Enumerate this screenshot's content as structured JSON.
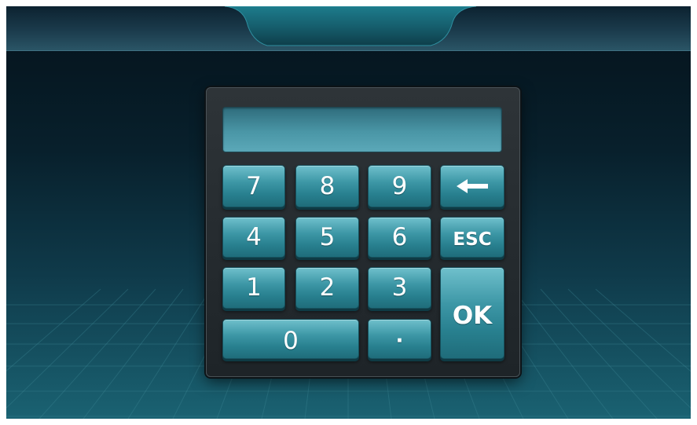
{
  "display": {
    "value": ""
  },
  "keys": {
    "k7": "7",
    "k8": "8",
    "k9": "9",
    "k4": "4",
    "k5": "5",
    "k6": "6",
    "k1": "1",
    "k2": "2",
    "k3": "3",
    "k0": "0",
    "kdot": "·",
    "esc": "ESC",
    "ok": "OK"
  },
  "icons": {
    "backspace": "left-arrow-icon"
  },
  "colors": {
    "key_top": "#6fc0cc",
    "key_bottom": "#1f6c7a",
    "panel": "#262c30",
    "display": "#4a96a6",
    "background_dark": "#04121b",
    "background_light": "#1a6272"
  }
}
